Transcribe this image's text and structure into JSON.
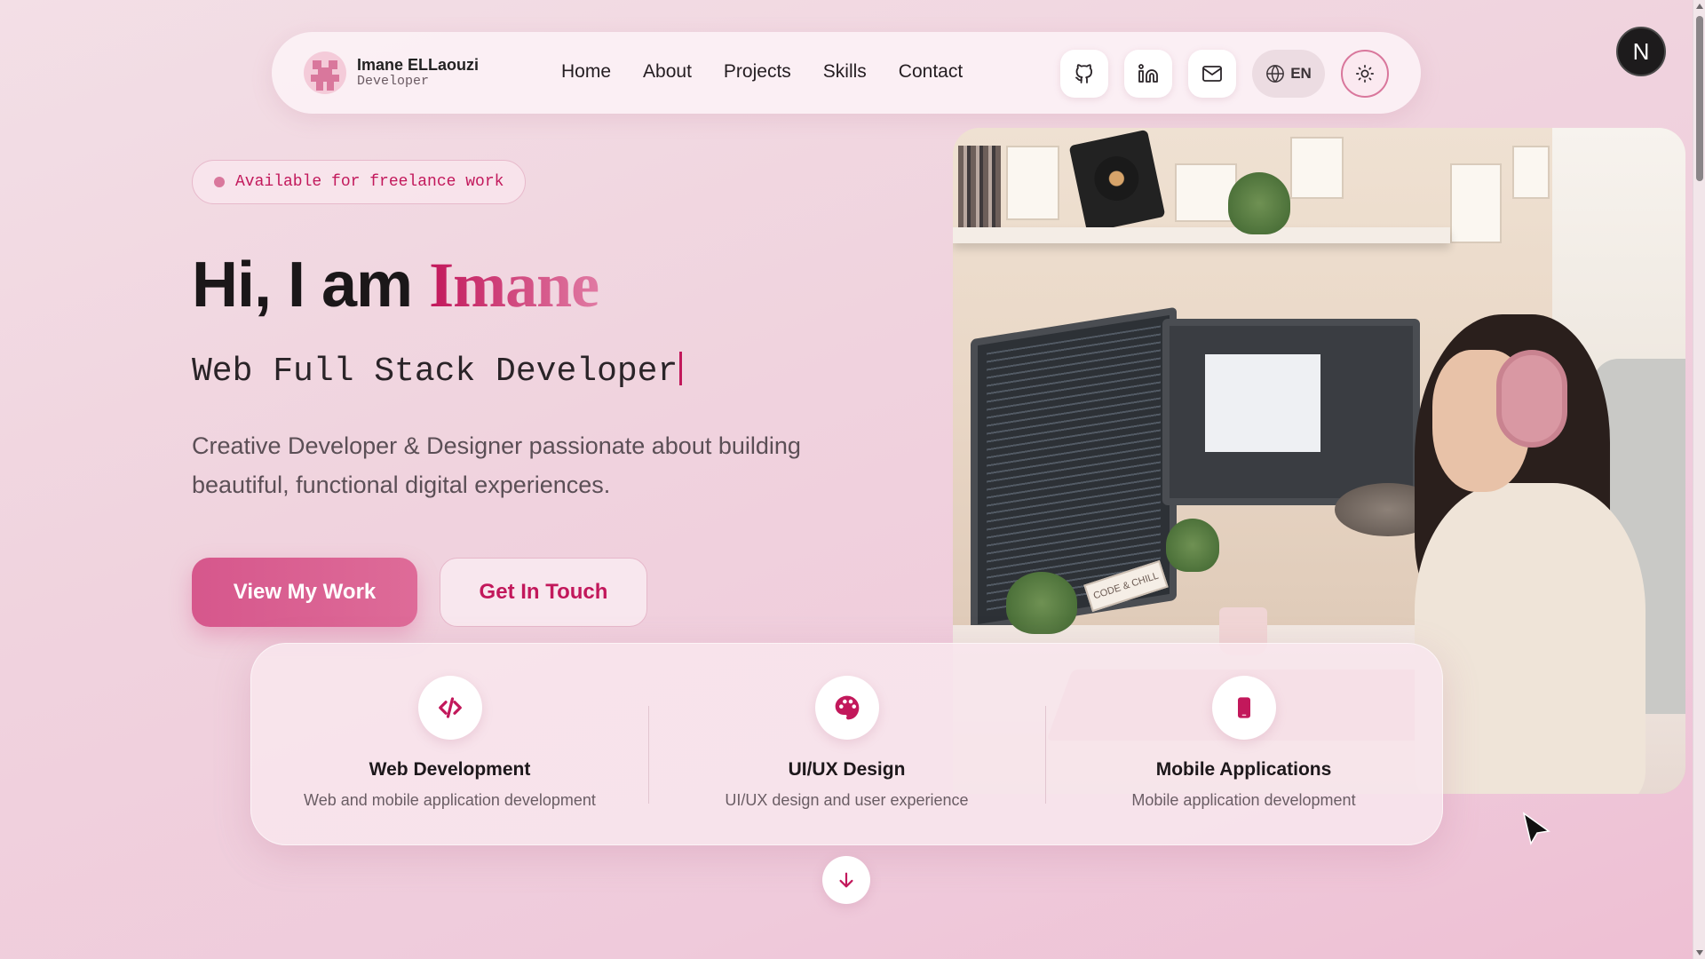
{
  "nav": {
    "brand_name": "Imane ELLaouzi",
    "brand_role": "Developer",
    "links": [
      "Home",
      "About",
      "Projects",
      "Skills",
      "Contact"
    ],
    "actions": {
      "github_icon": "github-icon",
      "linkedin_icon": "linkedin-icon",
      "mail_icon": "mail-icon",
      "lang_icon": "globe-icon",
      "lang_label": "EN",
      "theme_icon": "sun-icon"
    }
  },
  "corner_avatar": {
    "label": "N"
  },
  "hero": {
    "badge": "Available for freelance work",
    "title_prefix": "Hi, I am ",
    "title_name": "Imane",
    "subtitle": "Web Full Stack Developer",
    "description": "Creative Developer & Designer passionate about building beautiful, functional digital experiences.",
    "primary_button": "View My Work",
    "secondary_button": "Get In Touch",
    "image_sign_text": "CODE & CHILL"
  },
  "services": [
    {
      "icon": "code-icon",
      "title": "Web Development",
      "desc": "Web and mobile application development"
    },
    {
      "icon": "palette-icon",
      "title": "UI/UX Design",
      "desc": "UI/UX design and user experience"
    },
    {
      "icon": "smartphone-icon",
      "title": "Mobile Applications",
      "desc": "Mobile application development"
    }
  ],
  "scroll_down_icon": "arrow-down-icon",
  "colors": {
    "accent": "#c2185b",
    "accent_light": "#d9779c",
    "background": "#f0d3de"
  }
}
